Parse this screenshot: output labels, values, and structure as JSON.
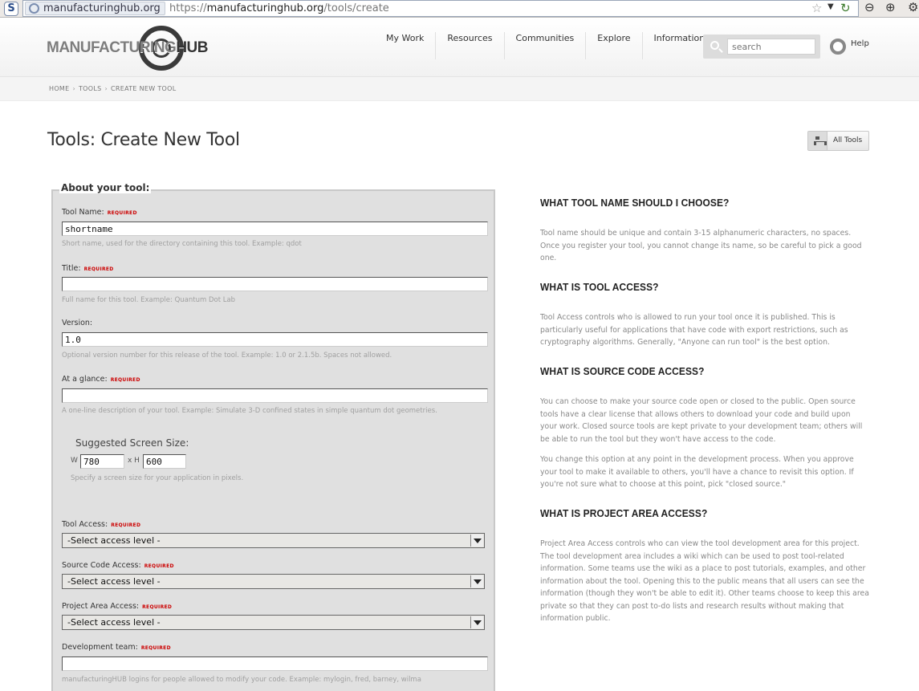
{
  "browser": {
    "identity": "manufacturinghub.org",
    "url_prefix": "https://",
    "url_domain": "manufacturinghub.org",
    "url_path": "/tools/create"
  },
  "site": {
    "logo_text_a": "MANUFACTURING",
    "logo_text_b": "HUB",
    "nav": [
      "My Work",
      "Resources",
      "Communities",
      "Explore",
      "Information"
    ],
    "search_placeholder": "search",
    "help_label": "Help"
  },
  "breadcrumb": [
    "HOME",
    "TOOLS",
    "CREATE NEW TOOL"
  ],
  "page": {
    "title": "Tools: Create New Tool",
    "all_tools_label": "All Tools"
  },
  "form": {
    "legend": "About your tool:",
    "required_tag": "REQUIRED",
    "tool_name_label": "Tool Name:",
    "tool_name_value": "shortname",
    "tool_name_hint": "Short name, used for the directory containing this tool. Example: qdot",
    "title_label": "Title:",
    "title_value": "",
    "title_hint": "Full name for this tool. Example: Quantum Dot Lab",
    "version_label": "Version:",
    "version_value": "1.0",
    "version_hint": "Optional version number for this release of the tool. Example: 1.0 or 2.1.5b. Spaces not allowed.",
    "glance_label": "At a glance:",
    "glance_value": "",
    "glance_hint": "A one-line description of your tool. Example: Simulate 3-D confined states in simple quantum dot geometries.",
    "screen_size_heading": "Suggested Screen Size:",
    "width_label": "W",
    "width_value": "780",
    "times_label": "x H",
    "height_value": "600",
    "screen_size_hint": "Specify a screen size for your application in pixels.",
    "tool_access_label": "Tool Access:",
    "tool_access_value": "-Select access level -",
    "source_access_label": "Source Code Access:",
    "source_access_value": "-Select access level -",
    "project_access_label": "Project Area Access:",
    "project_access_value": "-Select access level -",
    "dev_team_label": "Development team:",
    "dev_team_value": "",
    "dev_team_hint": "manufacturingHUB logins for people allowed to modify your code. Example: mylogin, fred, barney, wilma"
  },
  "help": {
    "q1": "WHAT TOOL NAME SHOULD I CHOOSE?",
    "a1": "Tool name should be unique and contain 3-15 alphanumeric characters, no spaces. Once you register your tool, you cannot change its name, so be careful to pick a good one.",
    "q2": "WHAT IS TOOL ACCESS?",
    "a2": "Tool Access controls who is allowed to run your tool once it is published. This is particularly useful for applications that have code with export restrictions, such as cryptography algorithms. Generally, \"Anyone can run tool\" is the best option.",
    "q3": "WHAT IS SOURCE CODE ACCESS?",
    "a3a": "You can choose to make your source code open or closed to the public. Open source tools have a clear license that allows others to download your code and build upon your work. Closed source tools are kept private to your development team; others will be able to run the tool but they won't have access to the code.",
    "a3b": "You change this option at any point in the development process. When you approve your tool to make it available to others, you'll have a chance to revisit this option. If you're not sure what to choose at this point, pick \"closed source.\"",
    "q4": "WHAT IS PROJECT AREA ACCESS?",
    "a4": "Project Area Access controls who can view the tool development area for this project. The tool development area includes a wiki which can be used to post tool-related information. Some teams use the wiki as a place to post tutorials, examples, and other information about the tool. Opening this to the public means that all users can see the information (though they won't be able to edit it). Other teams choose to keep this area private so that they can post to-do lists and research results without making that information public."
  }
}
